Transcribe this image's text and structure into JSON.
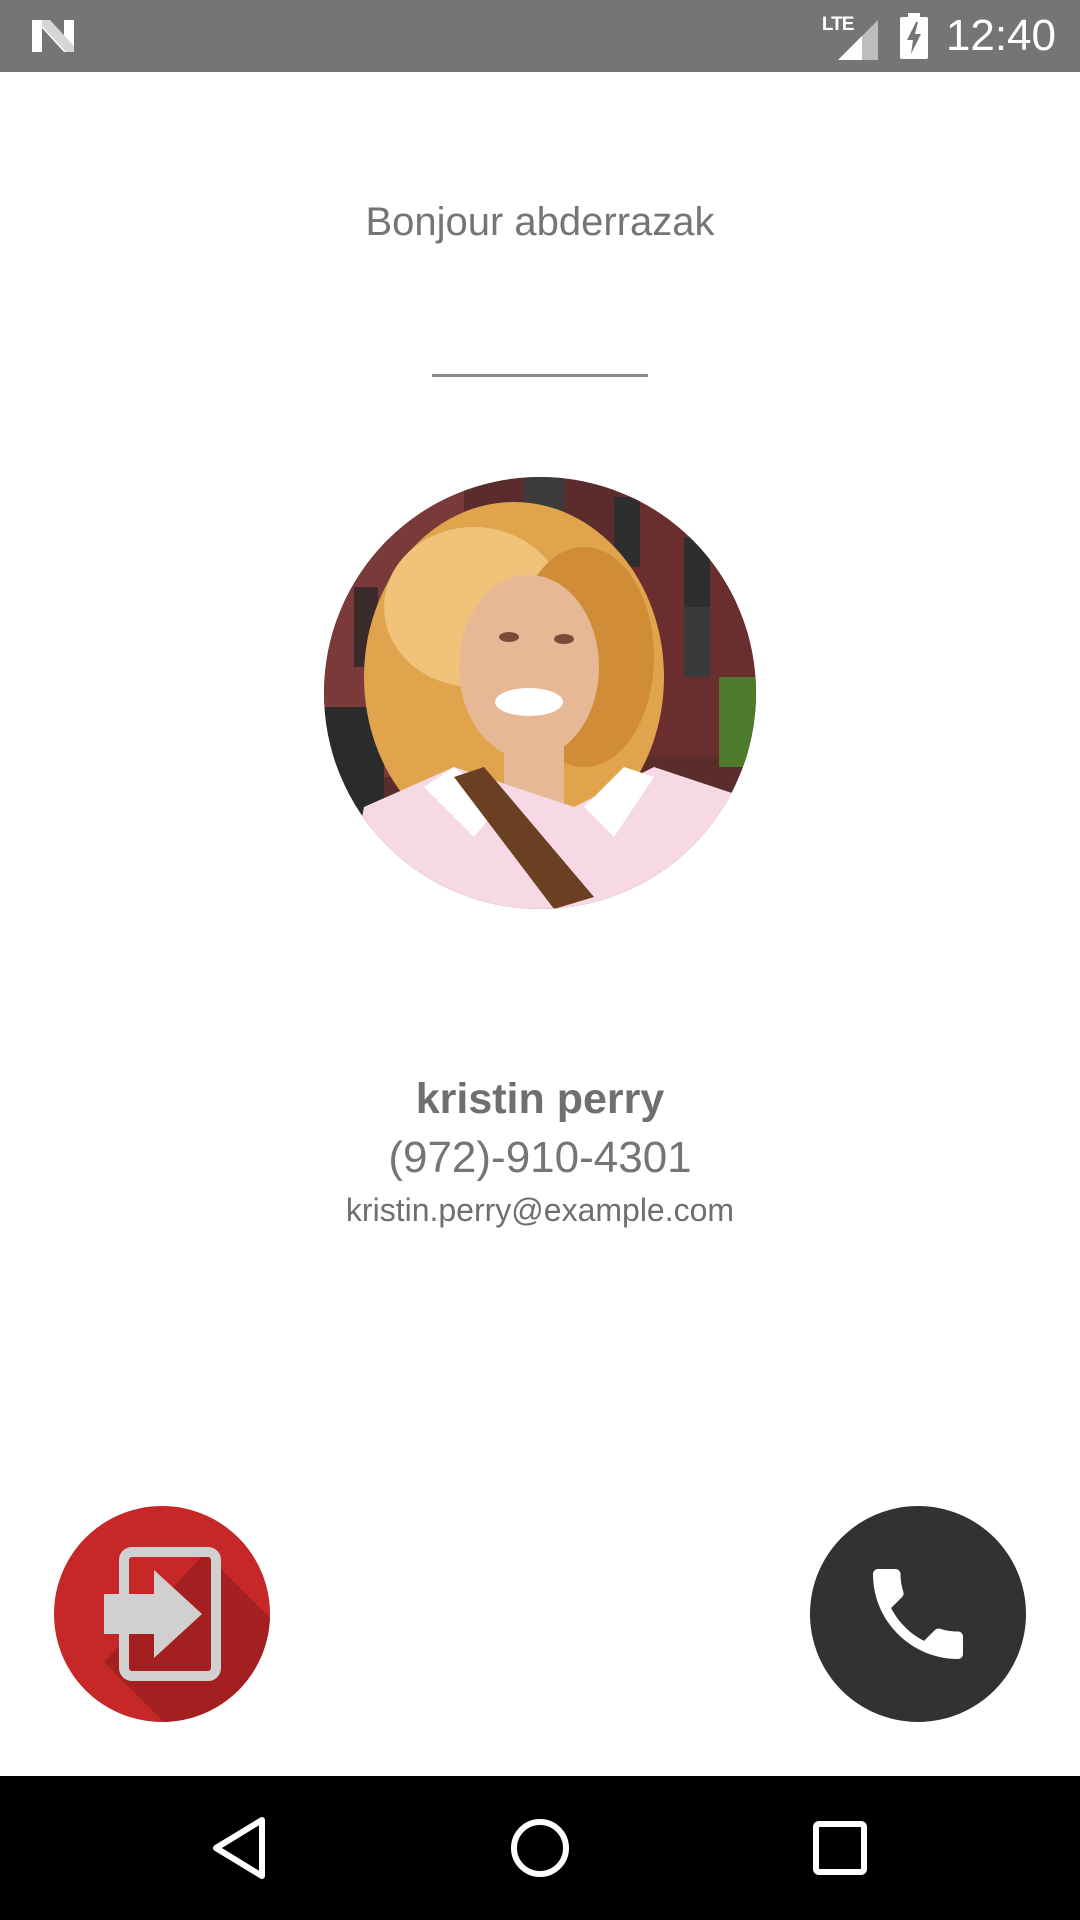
{
  "status_bar": {
    "network_label": "LTE",
    "time": "12:40",
    "icons": [
      "n-logo-icon",
      "signal-icon",
      "battery-charging-icon"
    ]
  },
  "greeting": "Bonjour abderrazak",
  "contact": {
    "name": "kristin perry",
    "phone": "(972)-910-4301",
    "email": "kristin.perry@example.com"
  },
  "actions": {
    "logout_icon": "exit-to-app-icon",
    "call_icon": "phone-icon"
  },
  "navigation": {
    "icons": [
      "back-icon",
      "home-icon",
      "recents-icon"
    ]
  },
  "colors": {
    "status_bar": "#757575",
    "logout_button": "#c62828",
    "call_button": "#323232",
    "text": "#757575",
    "nav_bar": "#000000"
  }
}
